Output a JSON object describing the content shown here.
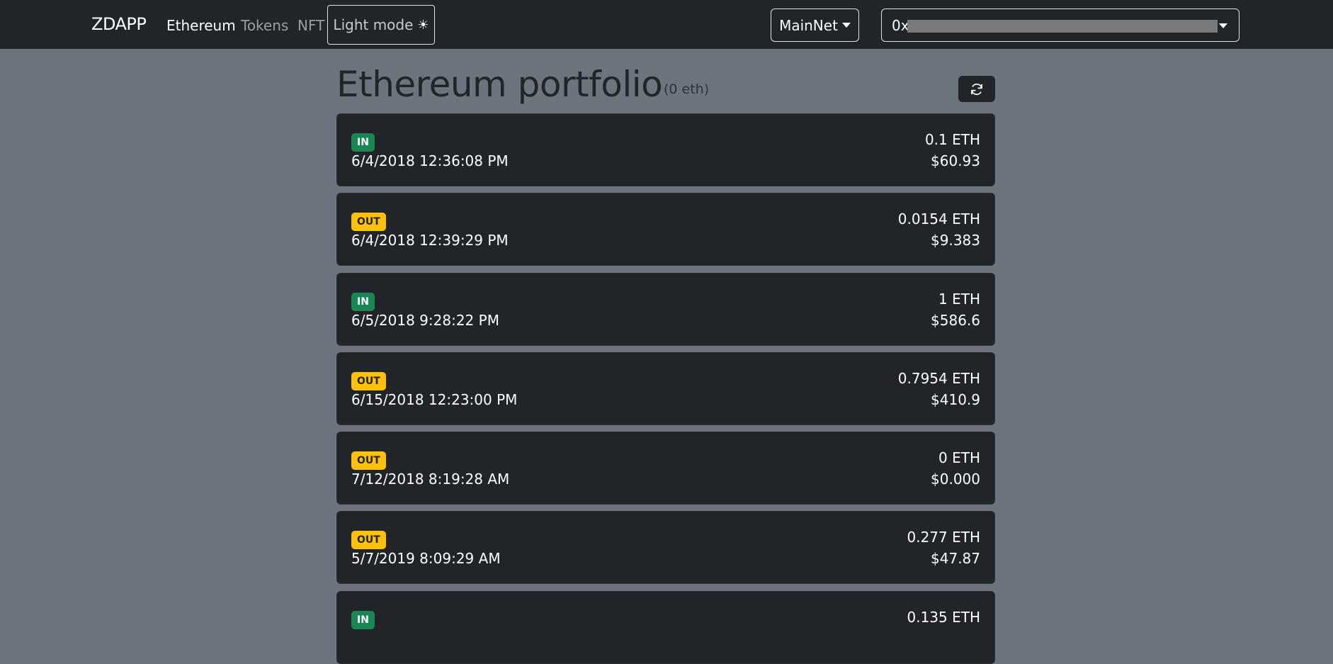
{
  "navbar": {
    "brand": "ZDAPP",
    "links": [
      {
        "label": "Ethereum",
        "active": true
      },
      {
        "label": "Tokens",
        "active": false
      },
      {
        "label": "NFT",
        "active": false
      }
    ],
    "theme_toggle_label": "Light mode",
    "theme_icon": "sun-icon",
    "network_label": "MainNet",
    "account_prefix": "0x"
  },
  "main": {
    "title": "Ethereum portfolio",
    "subtitle": "(0 eth)",
    "refresh_icon": "refresh-icon",
    "transactions": [
      {
        "direction": "IN",
        "date": "6/4/2018 12:36:08 PM",
        "eth": "0.1 ETH",
        "usd": "$60.93"
      },
      {
        "direction": "OUT",
        "date": "6/4/2018 12:39:29 PM",
        "eth": "0.0154 ETH",
        "usd": "$9.383"
      },
      {
        "direction": "IN",
        "date": "6/5/2018 9:28:22 PM",
        "eth": "1 ETH",
        "usd": "$586.6"
      },
      {
        "direction": "OUT",
        "date": "6/15/2018 12:23:00 PM",
        "eth": "0.7954 ETH",
        "usd": "$410.9"
      },
      {
        "direction": "OUT",
        "date": "7/12/2018 8:19:28 AM",
        "eth": "0 ETH",
        "usd": "$0.000"
      },
      {
        "direction": "OUT",
        "date": "5/7/2019 8:09:29 AM",
        "eth": "0.277 ETH",
        "usd": "$47.87"
      },
      {
        "direction": "IN",
        "date": "",
        "eth": "0.135 ETH",
        "usd": ""
      }
    ]
  },
  "colors": {
    "in_badge": "#198754",
    "out_badge": "#ffc107",
    "card_bg": "#212529",
    "page_bg": "#6c757d"
  }
}
